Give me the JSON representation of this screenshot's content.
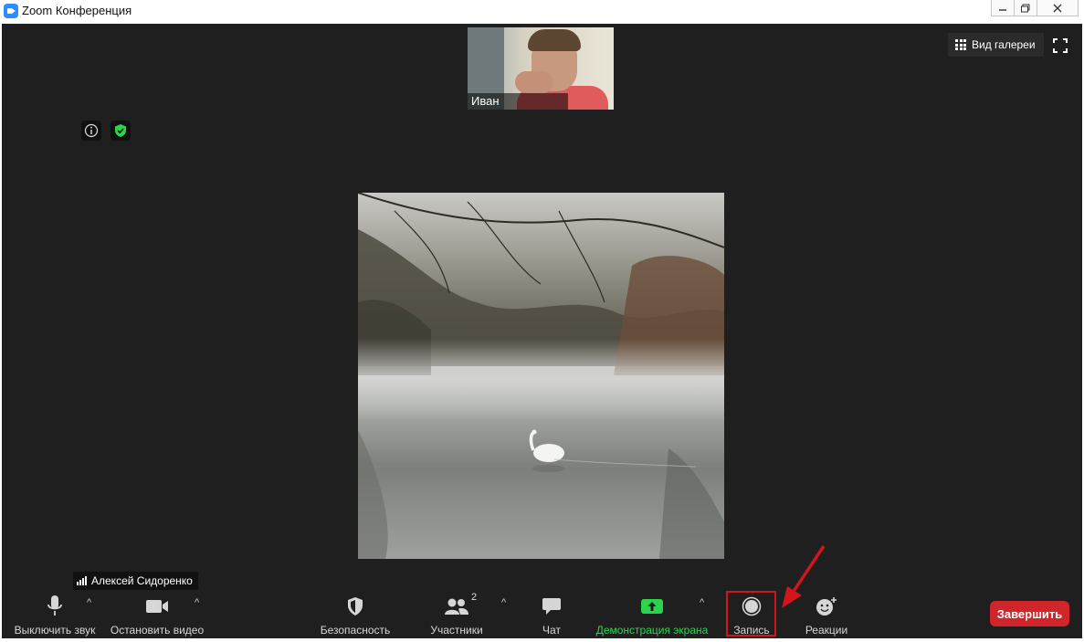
{
  "window": {
    "title": "Zoom Конференция",
    "controls": [
      "minimize",
      "maximize",
      "close"
    ]
  },
  "meeting": {
    "thumbnail": {
      "participant_name": "Иван"
    },
    "view_button": {
      "label": "Вид галереи",
      "icon": "grid-icon"
    },
    "fullscreen": {
      "icon": "fullscreen-icon"
    },
    "info": {
      "icon": "info-icon"
    },
    "encryption": {
      "icon": "shield-check-icon",
      "color": "#2bd44b"
    },
    "speaker_name": "Алексей Сидоренко"
  },
  "toolbar": {
    "mute": {
      "label": "Выключить звук",
      "icon": "microphone-icon"
    },
    "video": {
      "label": "Остановить видео",
      "icon": "video-camera-icon"
    },
    "security": {
      "label": "Безопасность",
      "icon": "shield-icon"
    },
    "participants": {
      "label": "Участники",
      "icon": "participants-icon",
      "count": "2"
    },
    "chat": {
      "label": "Чат",
      "icon": "chat-icon"
    },
    "share": {
      "label": "Демонстрация экрана",
      "icon": "share-screen-icon",
      "color": "#2bd44b"
    },
    "record": {
      "label": "Запись",
      "icon": "record-icon",
      "highlight_color": "#d0161b"
    },
    "reactions": {
      "label": "Реакции",
      "icon": "reactions-icon"
    },
    "end": {
      "label": "Завершить",
      "color": "#d0262b"
    }
  }
}
